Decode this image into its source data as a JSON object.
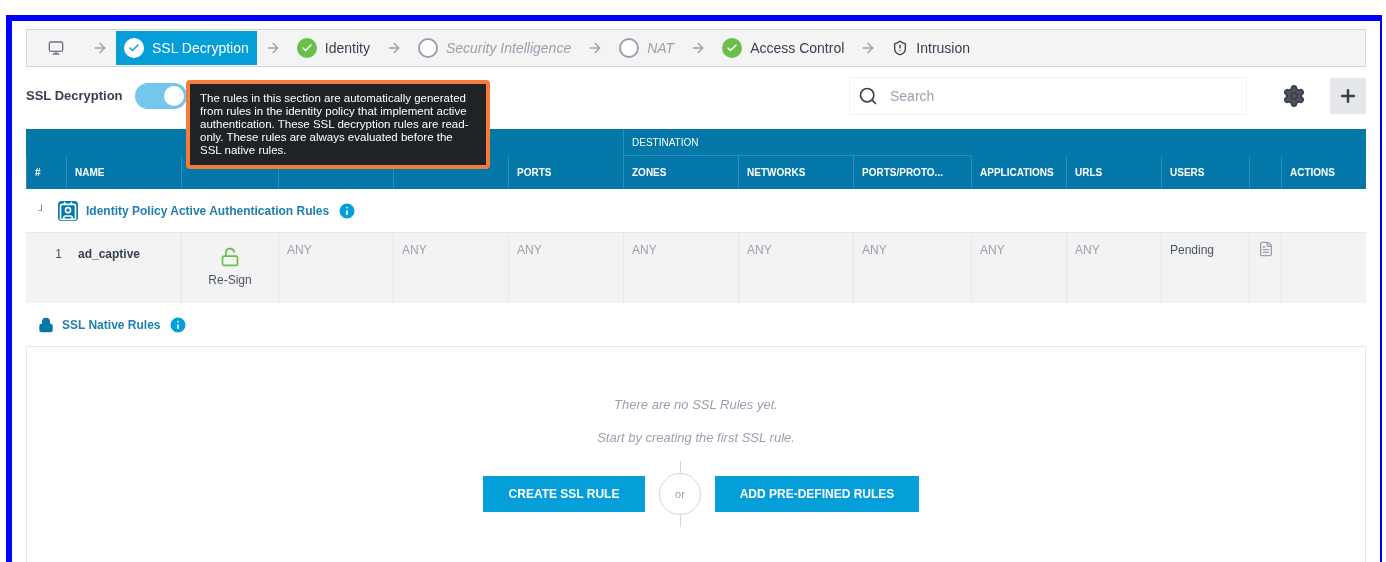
{
  "steps": [
    {
      "kind": "home"
    },
    {
      "kind": "step",
      "label": "SSL Decryption",
      "completed": true,
      "selected": true
    },
    {
      "kind": "step",
      "label": "Identity",
      "completed": true,
      "selected": false
    },
    {
      "kind": "step",
      "label": "Security Intelligence",
      "completed": false,
      "selected": false
    },
    {
      "kind": "step",
      "label": "NAT",
      "completed": false,
      "selected": false
    },
    {
      "kind": "step",
      "label": "Access Control",
      "completed": true,
      "selected": false
    },
    {
      "kind": "intrusion",
      "label": "Intrusion",
      "selected": false
    }
  ],
  "toolbar": {
    "title": "SSL Decryption",
    "toggle_on": true,
    "search": {
      "placeholder": "Search"
    }
  },
  "tooltip": "The rules in this section are automatically generated from rules in the identity policy that implement active authentication. These SSL decryption rules are read-only. These rules are always evaluated before the SSL native rules.",
  "table": {
    "group_header": "DESTINATION",
    "columns": [
      "#",
      "NAME",
      "",
      "",
      "",
      "PORTS",
      "ZONES",
      "NETWORKS",
      "PORTS/PROTO...",
      "APPLICATIONS",
      "URLS",
      "USERS",
      "",
      "ACTIONS"
    ],
    "sections": [
      {
        "kind": "identity",
        "title": "Identity Policy Active Authentication Rules",
        "expanded": true,
        "toggle_glyph": "┘",
        "rows": [
          {
            "number": "1",
            "name": "ad_captive",
            "action": "Re-Sign",
            "cells": [
              "ANY",
              "ANY",
              "ANY",
              "ANY",
              "ANY",
              "ANY",
              "ANY",
              "ANY"
            ],
            "users": "Pending"
          }
        ]
      },
      {
        "kind": "native",
        "title": "SSL Native Rules"
      }
    ]
  },
  "empty": {
    "message": "There are no SSL Rules yet.",
    "hint": "Start by creating the first SSL rule.",
    "create_button": "CREATE SSL RULE",
    "or": "or",
    "predefined_button": "ADD PRE-DEFINED RULES"
  }
}
